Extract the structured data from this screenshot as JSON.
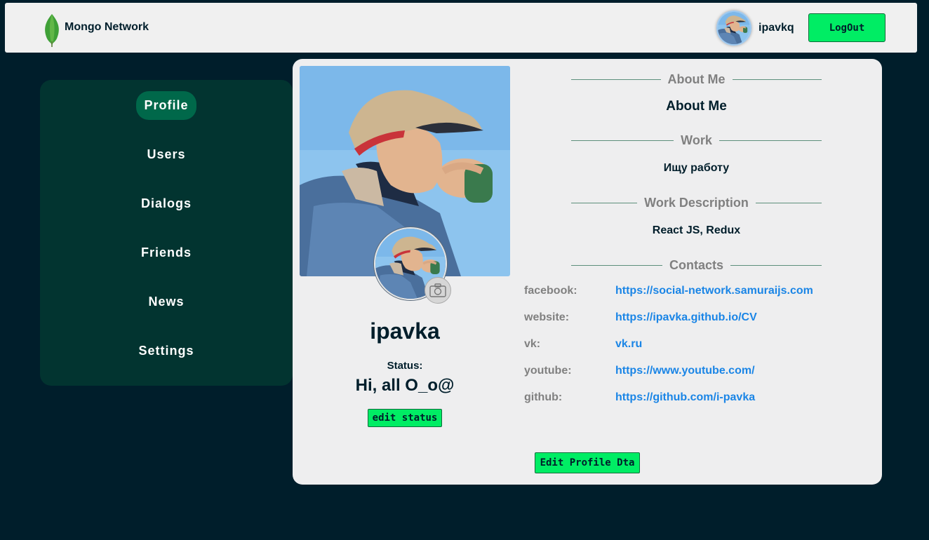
{
  "header": {
    "brand": "Mongo Network",
    "username": "ipavkq",
    "logout_label": "LogOut"
  },
  "sidebar": {
    "items": [
      {
        "label": "Profile",
        "active": true
      },
      {
        "label": "Users",
        "active": false
      },
      {
        "label": "Dialogs",
        "active": false
      },
      {
        "label": "Friends",
        "active": false
      },
      {
        "label": "News",
        "active": false
      },
      {
        "label": "Settings",
        "active": false
      }
    ]
  },
  "profile": {
    "name": "ipavka",
    "status_label": "Status:",
    "status_text": "Hi, all O_o@",
    "edit_status_label": "edit status",
    "edit_profile_label": "Edit Profile Dta"
  },
  "sections": {
    "about": {
      "heading": "About Me",
      "value": "About Me"
    },
    "work": {
      "heading": "Work",
      "value": "Ищу работу"
    },
    "work_description": {
      "heading": "Work Description",
      "value": "React JS, Redux"
    },
    "contacts_heading": "Contacts"
  },
  "contacts": [
    {
      "key": "facebook:",
      "value": "https://social-network.samuraijs.com"
    },
    {
      "key": "website:",
      "value": "https://ipavka.github.io/CV"
    },
    {
      "key": "vk:",
      "value": "vk.ru"
    },
    {
      "key": "youtube:",
      "value": "https://www.youtube.com/"
    },
    {
      "key": "github:",
      "value": "https://github.com/i-pavka"
    }
  ],
  "icons": {
    "logo": "mongodb-leaf-icon",
    "camera": "camera-icon"
  },
  "colors": {
    "page_bg": "#001e2b",
    "sidebar_bg": "#023430",
    "active_nav": "#00684a",
    "button_green": "#00ed64",
    "link_blue": "#1a85e6"
  }
}
